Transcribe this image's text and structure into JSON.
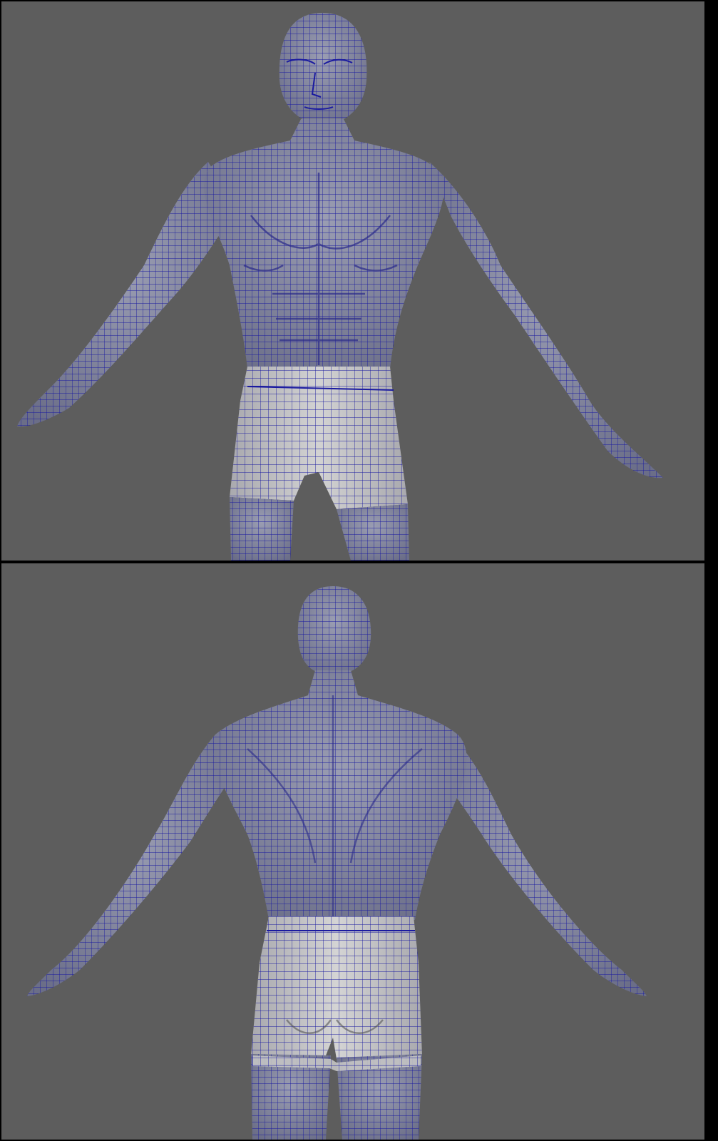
{
  "viewports": [
    {
      "view": "front"
    },
    {
      "view": "back"
    }
  ],
  "colors": {
    "frame": "#000000",
    "viewport_bg": "#5d5d5d",
    "skin": "#8f92a6",
    "skin_shadow": "#6b6e88",
    "shorts": "#c9c9c9",
    "shorts_shadow": "#a9a9ae",
    "wire": "#1a1aa0"
  }
}
